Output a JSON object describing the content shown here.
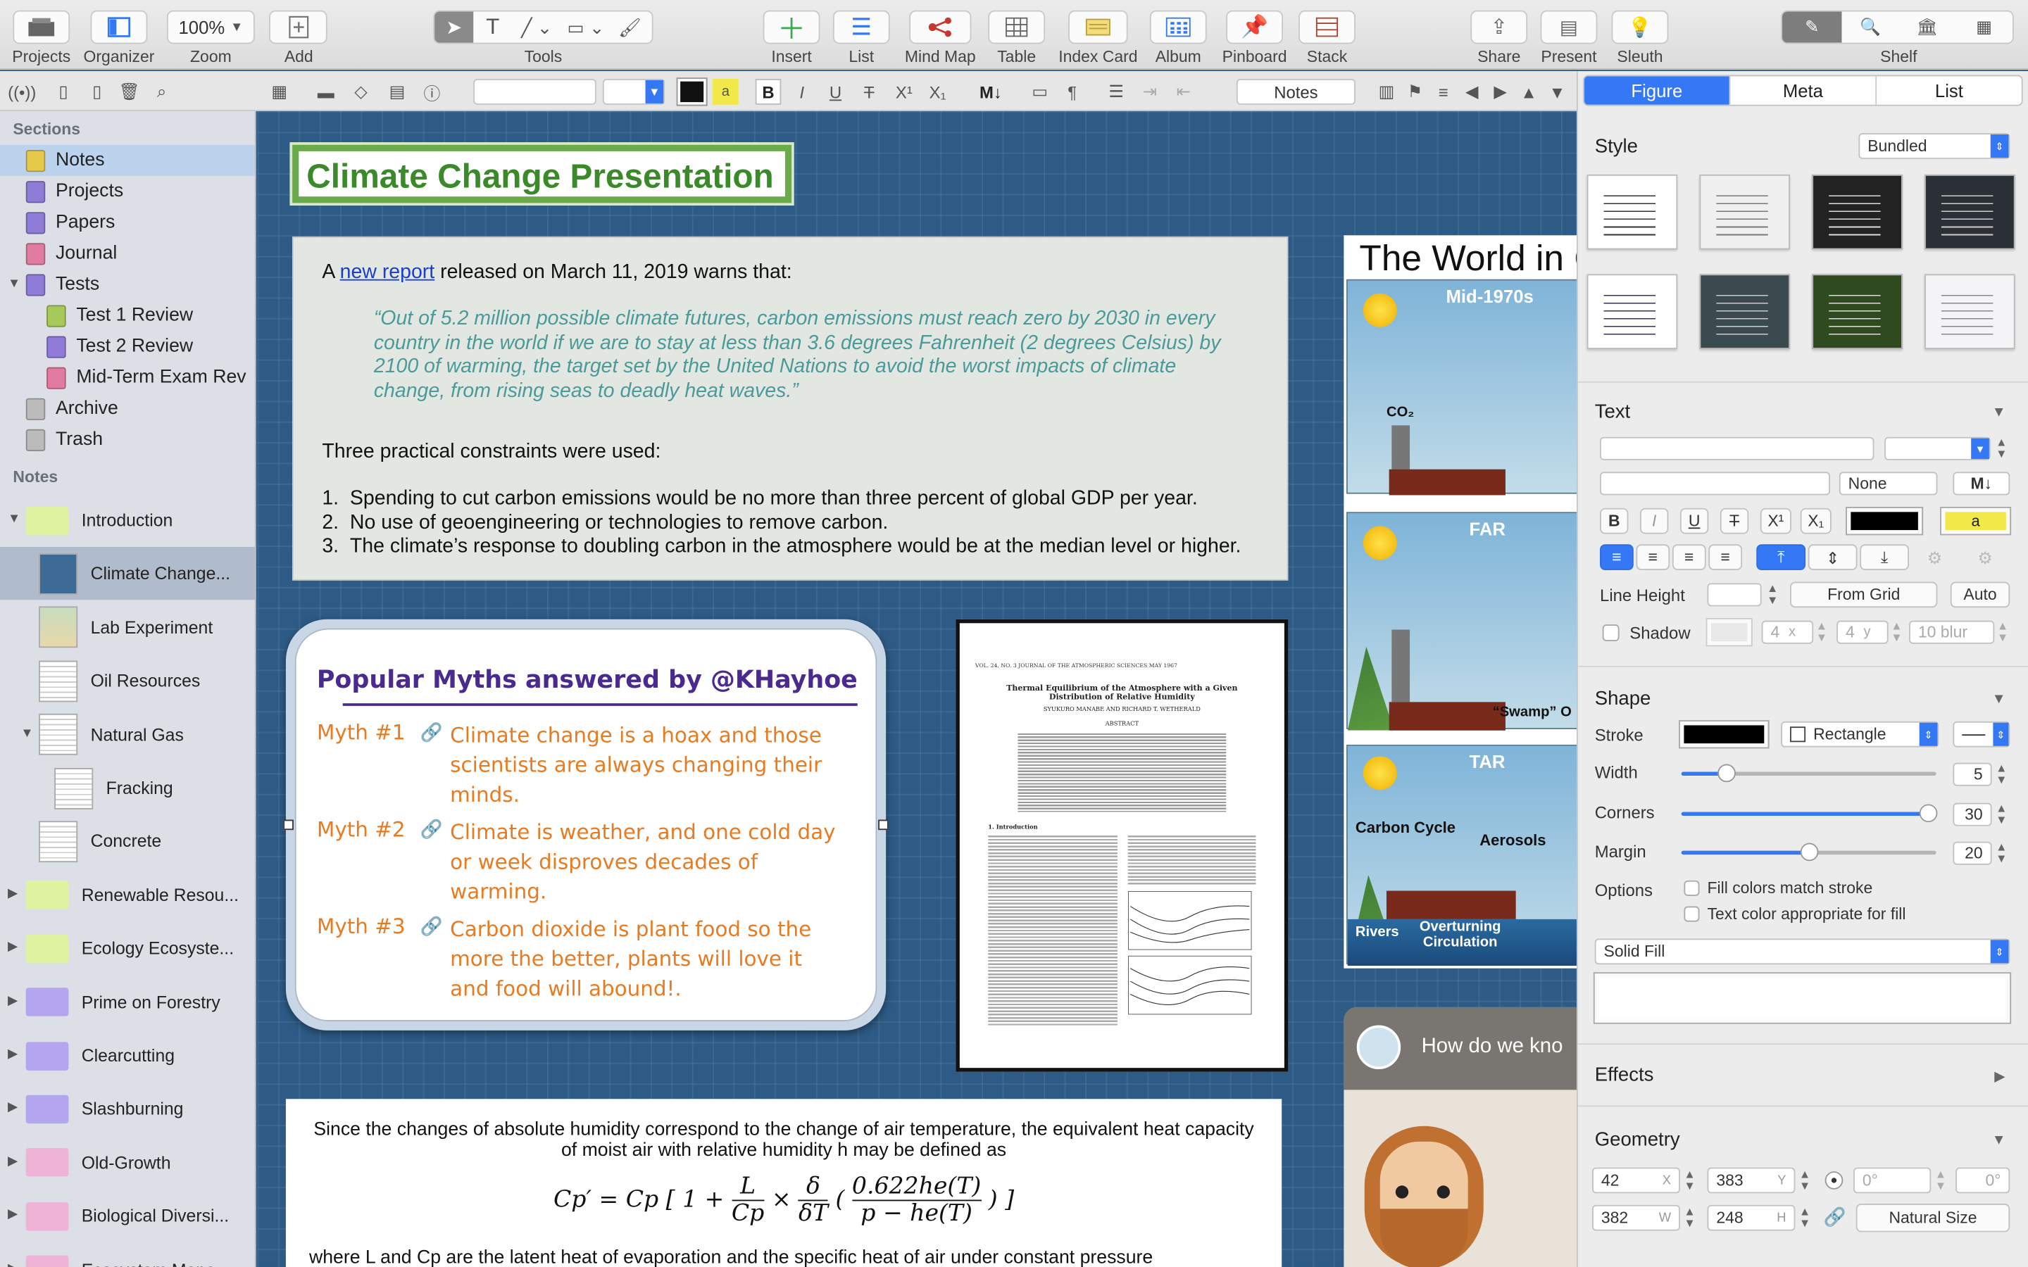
{
  "toolbar": {
    "items": [
      {
        "label": "Projects",
        "icon": "projects-icon"
      },
      {
        "label": "Organizer",
        "icon": "organizer-icon"
      },
      {
        "label": "Zoom",
        "value": "100%"
      },
      {
        "label": "Add",
        "icon": "add-icon"
      },
      {
        "label": "Tools"
      },
      {
        "label": "Insert"
      },
      {
        "label": "List"
      },
      {
        "label": "Mind Map"
      },
      {
        "label": "Table"
      },
      {
        "label": "Index Card"
      },
      {
        "label": "Album"
      },
      {
        "label": "Pinboard"
      },
      {
        "label": "Stack"
      },
      {
        "label": "Share"
      },
      {
        "label": "Present"
      },
      {
        "label": "Sleuth"
      },
      {
        "label": "Shelf"
      }
    ]
  },
  "format_bar": {
    "notes_label": "Notes",
    "bold": "B",
    "italic": "I",
    "underline": "U",
    "strike": "T",
    "superscript": "X¹",
    "subscript": "X₁",
    "markdown": "M↓",
    "highlight": "a"
  },
  "sidebar": {
    "sections_title": "Sections",
    "sections": [
      {
        "label": "Notes",
        "color": "#e6c84a"
      },
      {
        "label": "Projects",
        "color": "#8f7bd8"
      },
      {
        "label": "Papers",
        "color": "#8f7bd8"
      },
      {
        "label": "Journal",
        "color": "#e07ca0"
      },
      {
        "label": "Tests",
        "color": "#8f7bd8"
      },
      {
        "label": "Test 1 Review",
        "color": "#a8c85a"
      },
      {
        "label": "Test 2 Review",
        "color": "#8f7bd8"
      },
      {
        "label": "Mid-Term Exam Rev",
        "color": "#e07ca0"
      },
      {
        "label": "Archive",
        "color": "#bbbbbb"
      },
      {
        "label": "Trash",
        "color": "#bbbbbb"
      }
    ],
    "notes_title": "Notes",
    "notes": [
      {
        "label": "Introduction",
        "kind": "folder",
        "color": "#dff2a0"
      },
      {
        "label": "Climate Change...",
        "kind": "thumb"
      },
      {
        "label": "Lab Experiment",
        "kind": "thumb"
      },
      {
        "label": "Oil Resources",
        "kind": "thumb"
      },
      {
        "label": "Natural Gas",
        "kind": "thumb"
      },
      {
        "label": "Fracking",
        "kind": "thumb"
      },
      {
        "label": "Concrete",
        "kind": "thumb"
      },
      {
        "label": "Renewable Resou...",
        "kind": "folder",
        "color": "#dff2a0"
      },
      {
        "label": "Ecology Ecosyste...",
        "kind": "folder",
        "color": "#dff2a0"
      },
      {
        "label": "Prime on Forestry",
        "kind": "folder",
        "color": "#b4a5ef"
      },
      {
        "label": "Clearcutting",
        "kind": "folder",
        "color": "#b4a5ef"
      },
      {
        "label": "Slashburning",
        "kind": "folder",
        "color": "#b4a5ef"
      },
      {
        "label": "Old-Growth",
        "kind": "folder",
        "color": "#f0b3d8"
      },
      {
        "label": "Biological Diversi...",
        "kind": "folder",
        "color": "#f0b3d8"
      },
      {
        "label": "Ecosystem Mana...",
        "kind": "folder",
        "color": "#f0b3d8"
      }
    ]
  },
  "canvas": {
    "title": "Climate Change Presentation",
    "report": {
      "intro_before": "A ",
      "intro_link": "new report",
      "intro_after": " released on March 11, 2019 warns that:",
      "quote": "“Out of 5.2 million possible climate futures, carbon emissions must reach zero by 2030 in every country in the world if we are to stay at less than 3.6 degrees Fahrenheit (2 degrees Celsius) by 2100 of warming, the target set by the United Nations to avoid the worst impacts of climate change, from rising seas to deadly heat waves.”",
      "constraints_title": "Three practical constraints were used:",
      "constraints": [
        "Spending to cut carbon emissions would be no more than three percent of global GDP per year.",
        "No use of geoengineering or technologies to remove carbon.",
        "The climate’s response to doubling carbon in the atmosphere would be at the median level or higher."
      ]
    },
    "myths": {
      "title": "Popular Myths answered by @KHayhoe",
      "items": [
        {
          "label": "Myth #1",
          "text": "Climate change is a hoax and those scientists are always changing their minds."
        },
        {
          "label": "Myth #2",
          "text": "Climate is weather, and one cold day or week disproves decades of warming."
        },
        {
          "label": "Myth #3",
          "text": "Carbon dioxide is plant food so the more the better, plants will love it and food will abound!."
        }
      ]
    },
    "paper": {
      "header": "VOL. 24, NO. 3        JOURNAL OF THE ATMOSPHERIC SCIENCES        MAY 1967",
      "title": "Thermal Equilibrium of the Atmosphere with a Given Distribution of Relative Humidity",
      "authors": "SYUKURO MANABE AND RICHARD T. WETHERALD",
      "abstract": "ABSTRACT",
      "intro": "1. Introduction"
    },
    "world": {
      "title": "The World in C",
      "panels": [
        {
          "label": "Mid-1970s",
          "extra": "CO₂"
        },
        {
          "label": "FAR",
          "extra": "“Swamp” O"
        },
        {
          "label": "TAR",
          "extra": "Carbon Cycle",
          "extra2": "Aerosols",
          "extra3": "Rivers",
          "extra4": "Overturning Circulation"
        }
      ]
    },
    "video": {
      "title": "How do we kno"
    },
    "equation": {
      "text": "Since the changes of absolute humidity correspond to the change of air temperature, the equivalent heat capacity of moist air with relative humidity h may be defined as",
      "next": "where L and Cp are the latent heat of evaporation and the specific heat of air under constant pressure"
    }
  },
  "inspector": {
    "tabs": [
      "Figure",
      "Meta",
      "List"
    ],
    "style": {
      "title": "Style",
      "value": "Bundled"
    },
    "text": {
      "title": "Text",
      "none": "None",
      "markdown": "M↓",
      "line_height": "Line Height",
      "from_grid": "From Grid",
      "auto": "Auto",
      "shadow": "Shadow",
      "sx": "4",
      "sy": "4",
      "blur": "10 blur",
      "x_label": "x",
      "y_label": "y",
      "highlight": "a"
    },
    "shape": {
      "title": "Shape",
      "stroke": "Stroke",
      "shape_value": "Rectangle",
      "width_label": "Width",
      "width": "5",
      "width_frac": 0.18,
      "corners_label": "Corners",
      "corners": "30",
      "corners_frac": 0.97,
      "margin_label": "Margin",
      "margin": "20",
      "margin_frac": 0.5,
      "options": "Options",
      "opt1": "Fill colors match stroke",
      "opt2": "Text color appropriate for fill",
      "fill": "Solid Fill"
    },
    "effects": {
      "title": "Effects"
    },
    "geometry": {
      "title": "Geometry",
      "x": "42",
      "y": "383",
      "w": "382",
      "h": "248",
      "x_label": "X",
      "y_label": "Y",
      "w_label": "W",
      "h_label": "H",
      "angle1": "0°",
      "angle2": "0°",
      "natural": "Natural Size"
    }
  },
  "colors": {
    "accent": "#3478f6",
    "canvas": "#2d5b86",
    "title_green": "#3a8a2a",
    "myth_orange": "#e87b22",
    "myth_purple": "#4a2a8e",
    "quote_teal": "#4a9a9a"
  }
}
